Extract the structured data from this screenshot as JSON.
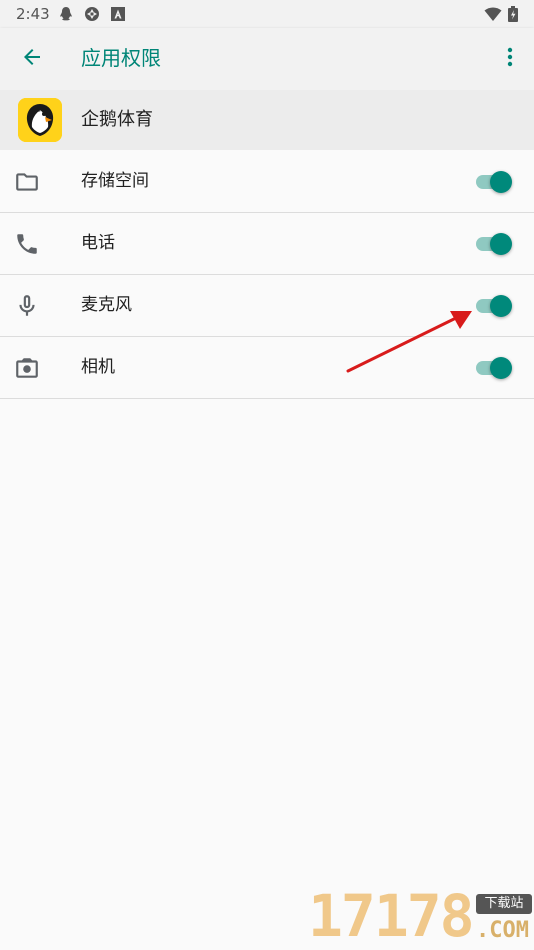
{
  "status_bar": {
    "time": "2:43",
    "icons": [
      "penguin-notification-icon",
      "aperture-icon",
      "text-a-icon",
      "wifi-icon",
      "battery-icon"
    ]
  },
  "app_bar": {
    "title": "应用权限",
    "back_icon": "arrow-back-icon",
    "more_icon": "more-vert-icon",
    "accent_color": "#008577"
  },
  "app": {
    "name": "企鹅体育",
    "logo_color": "#ffd21a"
  },
  "permissions": [
    {
      "label": "存储空间",
      "icon": "folder-icon",
      "enabled": true
    },
    {
      "label": "电话",
      "icon": "phone-icon",
      "enabled": true
    },
    {
      "label": "麦克风",
      "icon": "microphone-icon",
      "enabled": true
    },
    {
      "label": "相机",
      "icon": "camera-icon",
      "enabled": true
    }
  ],
  "toggle_colors": {
    "thumb": "#00897b",
    "track": "#8fc9c1"
  },
  "annotation": {
    "type": "arrow",
    "color": "#e02020",
    "points_to": "microphone-toggle"
  },
  "watermark": {
    "digits": "17178",
    "badge": "下载站",
    "suffix": ".COM"
  }
}
